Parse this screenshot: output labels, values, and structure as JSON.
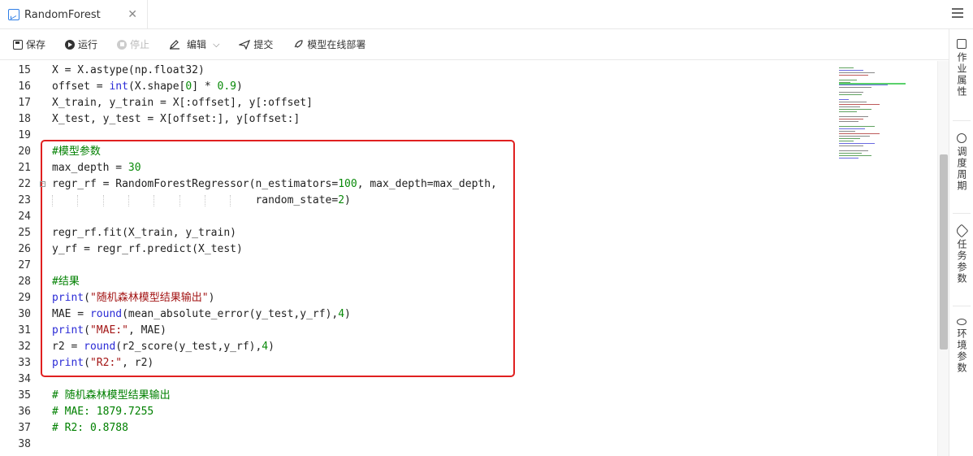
{
  "tab": {
    "title": "RandomForest",
    "close": "✕"
  },
  "toolbar": {
    "save": "保存",
    "run": "运行",
    "stop": "停止",
    "edit": "编辑",
    "submit": "提交",
    "deploy": "模型在线部署"
  },
  "editor": {
    "lines": [
      {
        "n": "15",
        "segs": [
          [
            "X = X.astype(np.float32)",
            ""
          ]
        ]
      },
      {
        "n": "16",
        "segs": [
          [
            "offset = ",
            ""
          ],
          [
            "int",
            "fn"
          ],
          [
            "(X.shape[",
            ""
          ],
          [
            "0",
            "num"
          ],
          [
            "] * ",
            ""
          ],
          [
            "0.9",
            "num"
          ],
          [
            ")",
            ""
          ]
        ]
      },
      {
        "n": "17",
        "segs": [
          [
            "X_train, y_train = X[:offset], y[:offset]",
            ""
          ]
        ]
      },
      {
        "n": "18",
        "segs": [
          [
            "X_test, y_test = X[offset:], y[offset:]",
            ""
          ]
        ]
      },
      {
        "n": "19",
        "segs": []
      },
      {
        "n": "20",
        "segs": [
          [
            "#模型参数",
            "cm"
          ]
        ]
      },
      {
        "n": "21",
        "segs": [
          [
            "max_depth = ",
            ""
          ],
          [
            "30",
            "num"
          ]
        ]
      },
      {
        "n": "22",
        "segs": [
          [
            "regr_rf = RandomForestRegressor(n_estimators=",
            ""
          ],
          [
            "100",
            "num"
          ],
          [
            ", max_depth=max_depth,",
            ""
          ]
        ]
      },
      {
        "n": "23",
        "segs": [
          [
            "                                random_state=",
            ""
          ],
          [
            "2",
            "num"
          ],
          [
            ")",
            ""
          ]
        ]
      },
      {
        "n": "24",
        "segs": []
      },
      {
        "n": "25",
        "segs": [
          [
            "regr_rf.fit(X_train, y_train)",
            ""
          ]
        ]
      },
      {
        "n": "26",
        "segs": [
          [
            "y_rf = regr_rf.predict(X_test)",
            ""
          ]
        ]
      },
      {
        "n": "27",
        "segs": []
      },
      {
        "n": "28",
        "segs": [
          [
            "#结果",
            "cm"
          ]
        ]
      },
      {
        "n": "29",
        "segs": [
          [
            "print",
            "fn"
          ],
          [
            "(",
            ""
          ],
          [
            "\"随机森林模型结果输出\"",
            "str"
          ],
          [
            ")",
            ""
          ]
        ]
      },
      {
        "n": "30",
        "segs": [
          [
            "MAE = ",
            ""
          ],
          [
            "round",
            "fn"
          ],
          [
            "(mean_absolute_error(y_test,y_rf),",
            ""
          ],
          [
            "4",
            "num"
          ],
          [
            ")",
            ""
          ]
        ]
      },
      {
        "n": "31",
        "segs": [
          [
            "print",
            "fn"
          ],
          [
            "(",
            ""
          ],
          [
            "\"MAE:\"",
            "str"
          ],
          [
            ", MAE)",
            ""
          ]
        ]
      },
      {
        "n": "32",
        "segs": [
          [
            "r2 = ",
            ""
          ],
          [
            "round",
            "fn"
          ],
          [
            "(r2_score(y_test,y_rf),",
            ""
          ],
          [
            "4",
            "num"
          ],
          [
            ")",
            ""
          ]
        ]
      },
      {
        "n": "33",
        "segs": [
          [
            "print",
            "fn"
          ],
          [
            "(",
            ""
          ],
          [
            "\"R2:\"",
            "str"
          ],
          [
            ", r2)",
            ""
          ]
        ]
      },
      {
        "n": "34",
        "segs": []
      },
      {
        "n": "35",
        "segs": [
          [
            "# 随机森林模型结果输出",
            "cm"
          ]
        ]
      },
      {
        "n": "36",
        "segs": [
          [
            "# MAE: 1879.7255",
            "cm"
          ]
        ]
      },
      {
        "n": "37",
        "segs": [
          [
            "# R2: 0.8788",
            "cm"
          ]
        ]
      },
      {
        "n": "38",
        "segs": []
      }
    ]
  },
  "sidebar": {
    "items": [
      {
        "label": "作业属性",
        "icon": "document-icon"
      },
      {
        "label": "调度周期",
        "icon": "clock-icon"
      },
      {
        "label": "任务参数",
        "icon": "tag-icon"
      },
      {
        "label": "环境参数",
        "icon": "eye-icon"
      }
    ]
  },
  "colors": {
    "highlight": "#e02020",
    "comment": "#008000",
    "number": "#0a8a0a",
    "function": "#2b2bd6",
    "string": "#a31515"
  }
}
